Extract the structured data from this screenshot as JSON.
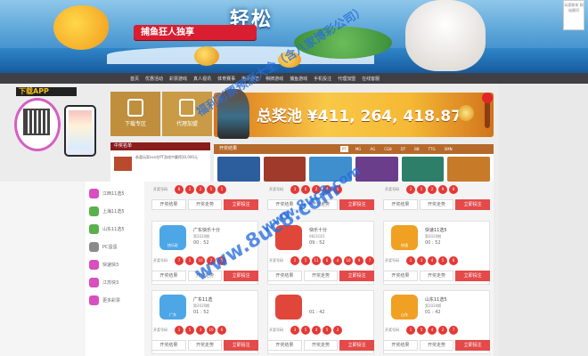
{
  "hero": {
    "title": "轻松",
    "ribbon": "捕鱼狂人独享",
    "corner": "玩家联系 网站顾问"
  },
  "nav": {
    "items": [
      "首页",
      "优惠活动",
      "彩票游戏",
      "真人视讯",
      "体育赛事",
      "电子游艺",
      "棋牌游戏",
      "捕鱼游戏",
      "手机投注",
      "代理加盟",
      "在线客服"
    ]
  },
  "app": {
    "title": "下载APP"
  },
  "services": [
    {
      "label": "下载专区"
    },
    {
      "label": "代理加盟"
    }
  ],
  "jackpot": {
    "text": "总奖池 ¥411, 264, 418.87"
  },
  "news": {
    "header": "中奖名单",
    "text": "恭喜玩家xxx在PT游戏中赢得30,000元"
  },
  "results": {
    "title": "开奖结果",
    "tabs": [
      "PT",
      "MG",
      "AG",
      "CG8",
      "DT",
      "BB",
      "TTG",
      "SMN"
    ]
  },
  "sidebar": {
    "items": [
      "江西11选5",
      "上海11选5",
      "山东11选5",
      "PC蛋蛋",
      "快速快3",
      "江苏快3",
      "更多彩票"
    ]
  },
  "cards": [
    {
      "name": "",
      "issue": "",
      "timer": "",
      "balls_label": "开奖号码",
      "balls": [
        "8",
        "2",
        "2",
        "5",
        "5"
      ],
      "btn1": "开奖结果",
      "btn2": "开奖走势",
      "btn3": "立即投注"
    },
    {
      "name": "",
      "issue": "",
      "timer": "",
      "balls_label": "开奖号码",
      "balls": [
        "3",
        "6",
        "2",
        "4",
        "5"
      ],
      "btn1": "开奖结果",
      "btn2": "开奖走势",
      "btn3": "立即投注"
    },
    {
      "name": "",
      "issue": "",
      "timer": "",
      "balls_label": "开奖号码",
      "balls": [
        "2",
        "5",
        "2",
        "9",
        "8"
      ],
      "btn1": "开奖结果",
      "btn2": "开奖走势",
      "btn3": "立即投注"
    },
    {
      "name": "广东快乐十分",
      "issue": "第2020期",
      "timer": "00 : 52",
      "logo": "快乐彩",
      "balls_label": "开奖号码",
      "balls": [
        "7",
        "1",
        "10",
        "2",
        "5"
      ],
      "btn1": "开奖结果",
      "btn2": "开奖走势",
      "btn3": "立即投注"
    },
    {
      "name": "快乐十分",
      "issue": "0821021",
      "timer": "09 : 52",
      "logo": "",
      "balls_label": "开奖号码",
      "balls": [
        "2",
        "5",
        "11",
        "6",
        "4",
        "10",
        "9",
        "7"
      ],
      "btn1": "开奖结果",
      "btn2": "开奖走势",
      "btn3": "立即投注"
    },
    {
      "name": "快速11选5",
      "issue": "第2020期",
      "timer": "00 : 52",
      "logo": "快速",
      "balls_label": "开奖号码",
      "balls": [
        "1",
        "3",
        "4",
        "5",
        "8"
      ],
      "btn1": "开奖结果",
      "btn2": "开奖走势",
      "btn3": "立即投注"
    },
    {
      "name": "广东11选",
      "issue": "第2020期",
      "timer": "01 : 52",
      "logo": "广东",
      "balls_label": "开奖号码",
      "balls": [
        "1",
        "5",
        "3",
        "10",
        "6"
      ],
      "btn1": "开奖结果",
      "btn2": "开奖走势",
      "btn3": "立即投注"
    },
    {
      "name": "",
      "issue": "",
      "timer": "01 : 42",
      "logo": "",
      "balls_label": "开奖号码",
      "balls": [
        "3",
        "5",
        "4",
        "5",
        "2"
      ],
      "btn1": "开奖结果",
      "btn2": "开奖走势",
      "btn3": "立即投注"
    },
    {
      "name": "山东11选5",
      "issue": "第2020期",
      "timer": "01 : 42",
      "logo": "山东",
      "balls_label": "开奖号码",
      "balls": [
        "1",
        "5",
        "4",
        "2",
        "7"
      ],
      "btn1": "开奖结果",
      "btn2": "开奖走势",
      "btn3": "立即投注"
    }
  ],
  "watermark": {
    "line1": "福利彩票预测大全（含八家博彩公司）",
    "line2": "www.8uc8.com",
    "line3": "www.8uc8.com"
  },
  "colors": {
    "nav_bg": "#3f3f44",
    "accent_red": "#e44a4a",
    "jackpot": "#f5b934",
    "watermark": "#286edc"
  }
}
